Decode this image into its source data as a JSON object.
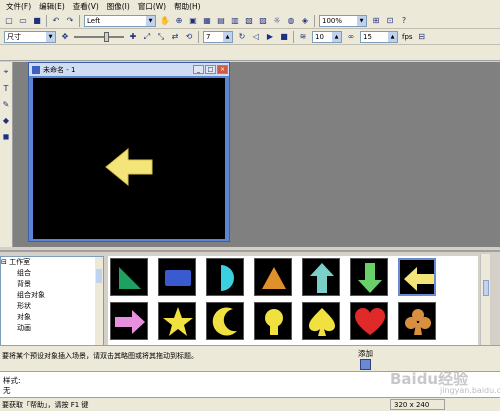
{
  "menu": [
    "文件(F)",
    "编辑(E)",
    "查看(V)",
    "图像(I)",
    "窗口(W)",
    "帮助(H)"
  ],
  "toolbar": {
    "align_value": "Left",
    "zoom_value": "100%",
    "size_value": "尺寸",
    "frame_value": "7",
    "spin_a_value": "10",
    "spin_b_value": "15",
    "fps_label": "fps"
  },
  "document": {
    "title": "未命名 - 1"
  },
  "tree": {
    "items": [
      "工作室",
      "组合",
      "背景",
      "组合对象",
      "形状",
      "对象",
      "动画"
    ]
  },
  "gallery": {
    "items": [
      "triangle-green",
      "rect-blue",
      "half-circle-cyan",
      "triangle-orange",
      "arrow-up-cyan",
      "arrow-down-green",
      "arrow-left-yellow",
      "arrow-right-pink",
      "star-yellow",
      "crescent-yellow",
      "bulb-yellow",
      "spade-yellow",
      "heart-red",
      "club-orange"
    ],
    "selected": "arrow-left-yellow"
  },
  "hint": "要将某个预设对象插入场景，请双击其略图或将其拖动到标题。",
  "add_label": "添加",
  "style": {
    "label": "样式:",
    "value": "无"
  },
  "status": {
    "text": "要获取「帮助」，请按 F1 键",
    "size": "320 x 240"
  },
  "watermark": {
    "main": "Baidu经验",
    "sub": "jingyan.baidu.com"
  }
}
